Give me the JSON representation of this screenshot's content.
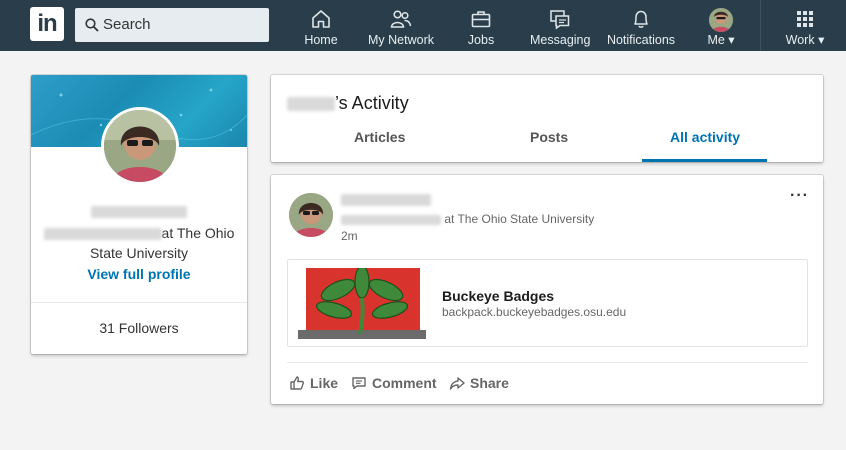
{
  "nav": {
    "logo_text": "in",
    "search_placeholder": "Search",
    "items": [
      {
        "label": "Home",
        "icon": "home-icon"
      },
      {
        "label": "My Network",
        "icon": "network-icon"
      },
      {
        "label": "Jobs",
        "icon": "briefcase-icon"
      },
      {
        "label": "Messaging",
        "icon": "messaging-icon"
      },
      {
        "label": "Notifications",
        "icon": "bell-icon"
      },
      {
        "label": "Me ▾",
        "icon": "avatar"
      },
      {
        "label": "Work ▾",
        "icon": "grid-icon"
      }
    ]
  },
  "profile": {
    "headline_suffix": "at The Ohio State University",
    "view_profile": "View full profile",
    "followers": "31 Followers"
  },
  "activity": {
    "title_suffix": "’s Activity",
    "tabs": [
      "Articles",
      "Posts",
      "All activity"
    ],
    "active_tab": "All activity"
  },
  "post": {
    "headline_suffix": "at The Ohio State University",
    "time": "2m",
    "more": "···",
    "attachment": {
      "title": "Buckeye Badges",
      "url": "backpack.buckeyebadges.osu.edu"
    },
    "actions": [
      "Like",
      "Comment",
      "Share"
    ]
  },
  "colors": {
    "nav_bg": "#293e4a",
    "accent": "#0073b1",
    "page_bg": "#f3f3f3"
  }
}
